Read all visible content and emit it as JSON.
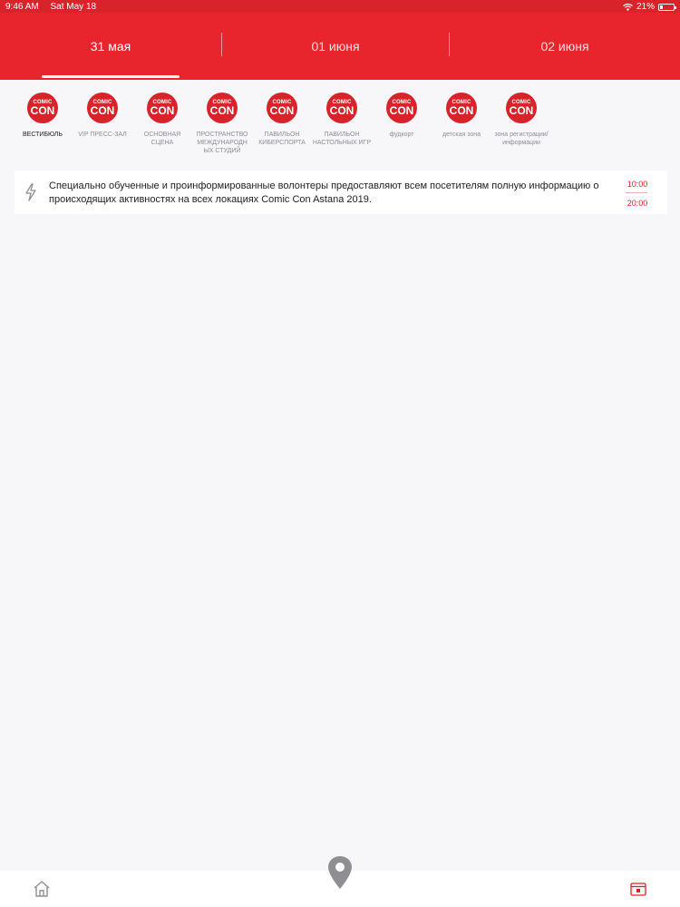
{
  "status": {
    "time": "9:46 AM",
    "date": "Sat May 18",
    "battery": "21%",
    "battery_level": 0.21
  },
  "tabs": [
    {
      "label": "31 мая"
    },
    {
      "label": "01 июня"
    },
    {
      "label": "02 июня"
    }
  ],
  "locations": [
    {
      "logo_top": "COMIC",
      "logo_bottom": "CON",
      "label": "ВЕСТИБЮЛЬ"
    },
    {
      "logo_top": "COMIC",
      "logo_bottom": "CON",
      "label": "VIP ПРЕСС-ЗАЛ"
    },
    {
      "logo_top": "COMIC",
      "logo_bottom": "CON",
      "label": "ОСНОВНАЯ СЦЕНА"
    },
    {
      "logo_top": "COMIC",
      "logo_bottom": "CON",
      "label": "ПРОСТРАНСТВО МЕЖДУНАРОДН ЫХ СТУДИЙ"
    },
    {
      "logo_top": "COMIC",
      "logo_bottom": "CON",
      "label": "ПАВИЛЬОН КИБЕРСПОРТА"
    },
    {
      "logo_top": "COMIC",
      "logo_bottom": "CON",
      "label": "ПАВИЛЬОН НАСТОЛЬНЫХ ИГР"
    },
    {
      "logo_top": "COMIC",
      "logo_bottom": "CON",
      "label": "фудкорт"
    },
    {
      "logo_top": "COMIC",
      "logo_bottom": "CON",
      "label": "детская зона"
    },
    {
      "logo_top": "COMIC",
      "logo_bottom": "CON",
      "label": "зона регистрации/ информации"
    }
  ],
  "event": {
    "text": "Специально обученные и проинформированные волонтеры предоставляют всем посетителям полную информацию о происходящих активностях на всех локациях Comic Con Astana 2019.",
    "start": "10:00",
    "end": "20:00",
    "icon": "lightning-icon"
  },
  "nav": {
    "home_icon": "home-icon",
    "map_icon": "map-pin-icon",
    "calendar_icon": "calendar-icon"
  },
  "colors": {
    "brand_red": "#e8242d",
    "status_red": "#d9232b",
    "background": "#f7f7fa"
  }
}
